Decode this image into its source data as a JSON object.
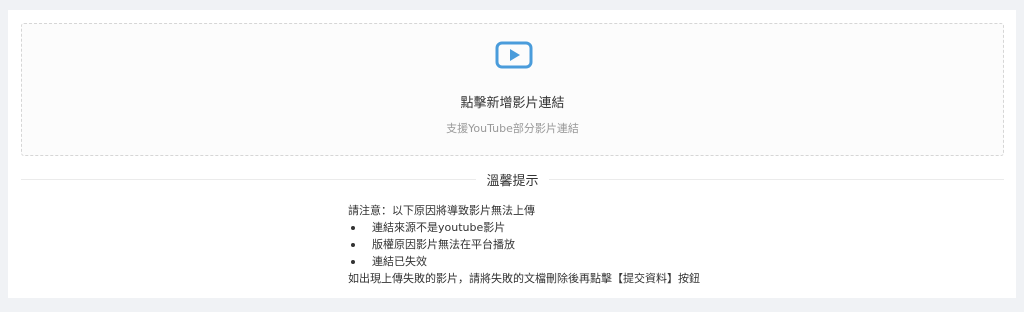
{
  "upload": {
    "icon": "video-play-icon",
    "accent_color": "#4a9cdb",
    "title": "點擊新增影片連結",
    "hint": "支援YouTube部分影片連結"
  },
  "notice": {
    "heading": "溫馨提示",
    "intro": "請注意：以下原因將導致影片無法上傳",
    "items": [
      "連結來源不是youtube影片",
      "版權原因影片無法在平台播放",
      "連結已失效"
    ],
    "footer": "如出現上傳失敗的影片，請將失敗的文檔刪除後再點擊【提交資料】按鈕"
  }
}
